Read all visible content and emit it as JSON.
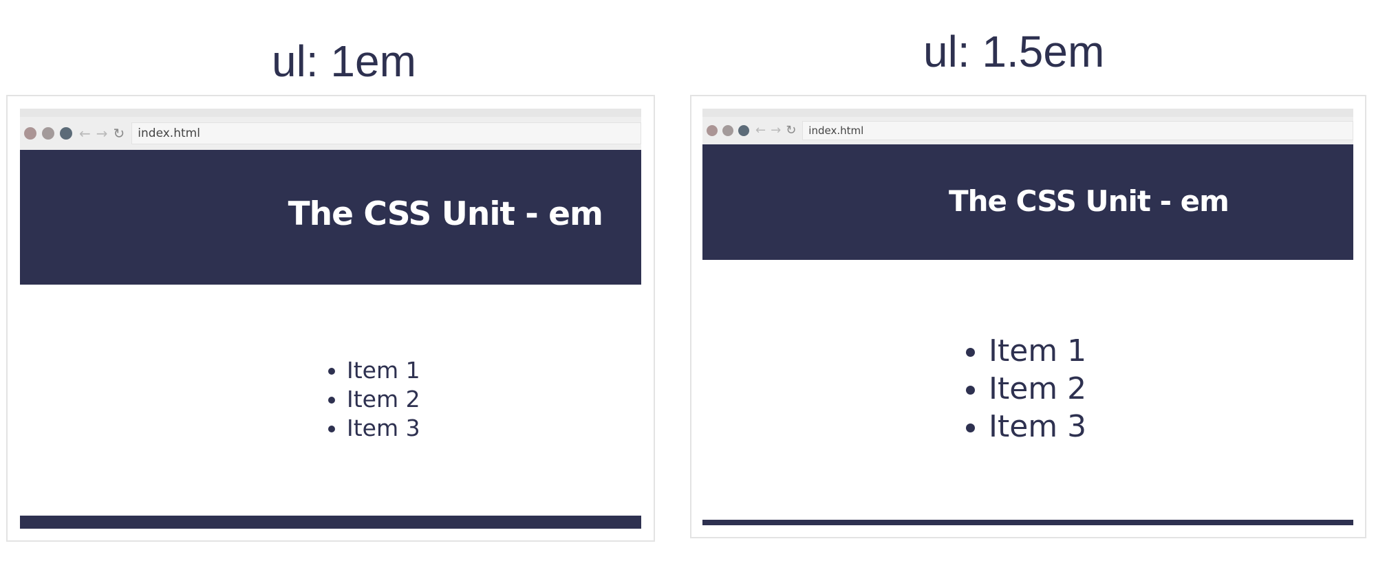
{
  "left": {
    "caption": "ul: 1em",
    "browser": {
      "url": "index.html"
    },
    "header_title": "The CSS Unit - em",
    "list_items": [
      "Item 1",
      "Item 2",
      "Item 3"
    ]
  },
  "right": {
    "caption": "ul: 1.5em",
    "browser": {
      "url": "index.html"
    },
    "header_title": "The CSS Unit - em",
    "list_items": [
      "Item 1",
      "Item 2",
      "Item 3"
    ]
  },
  "colors": {
    "navy": "#2e3150",
    "traffic_light_close": "#ab9595",
    "traffic_light_minimize": "#a39a9a",
    "traffic_light_zoom": "#5c6b78"
  },
  "icons": [
    "back-arrow-icon",
    "forward-arrow-icon",
    "reload-icon"
  ]
}
